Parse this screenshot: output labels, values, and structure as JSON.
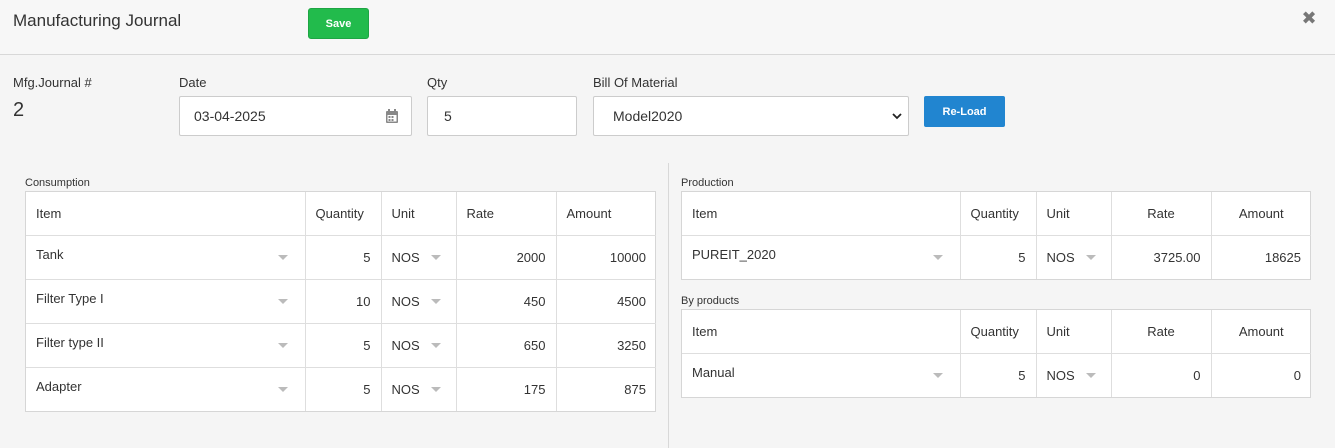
{
  "header": {
    "title": "Manufacturing Journal",
    "save_label": "Save",
    "close_icon": "close-icon"
  },
  "form": {
    "journal_label": "Mfg.Journal #",
    "journal_no": "2",
    "date_label": "Date",
    "date_value": "03-04-2025",
    "qty_label": "Qty",
    "qty_value": "5",
    "bom_label": "Bill Of Material",
    "bom_value": "Model2020",
    "reload_label": "Re-Load"
  },
  "consumption": {
    "label": "Consumption",
    "columns": [
      "Item",
      "Quantity",
      "Unit",
      "Rate",
      "Amount"
    ],
    "rows": [
      {
        "item": "Tank",
        "quantity": "5",
        "unit": "NOS",
        "rate": "2000",
        "amount": "10000"
      },
      {
        "item": "Filter Type I",
        "quantity": "10",
        "unit": "NOS",
        "rate": "450",
        "amount": "4500"
      },
      {
        "item": "Filter type II",
        "quantity": "5",
        "unit": "NOS",
        "rate": "650",
        "amount": "3250"
      },
      {
        "item": "Adapter",
        "quantity": "5",
        "unit": "NOS",
        "rate": "175",
        "amount": "875"
      }
    ]
  },
  "production": {
    "label": "Production",
    "columns": [
      "Item",
      "Quantity",
      "Unit",
      "Rate",
      "Amount"
    ],
    "rows": [
      {
        "item": "PUREIT_2020",
        "quantity": "5",
        "unit": "NOS",
        "rate": "3725.00",
        "amount": "18625"
      }
    ]
  },
  "byproducts": {
    "label": "By products",
    "columns": [
      "Item",
      "Quantity",
      "Unit",
      "Rate",
      "Amount"
    ],
    "rows": [
      {
        "item": "Manual",
        "quantity": "5",
        "unit": "NOS",
        "rate": "0",
        "amount": "0"
      }
    ]
  },
  "colors": {
    "save": "#22bb4c",
    "reload": "#2185d0"
  }
}
